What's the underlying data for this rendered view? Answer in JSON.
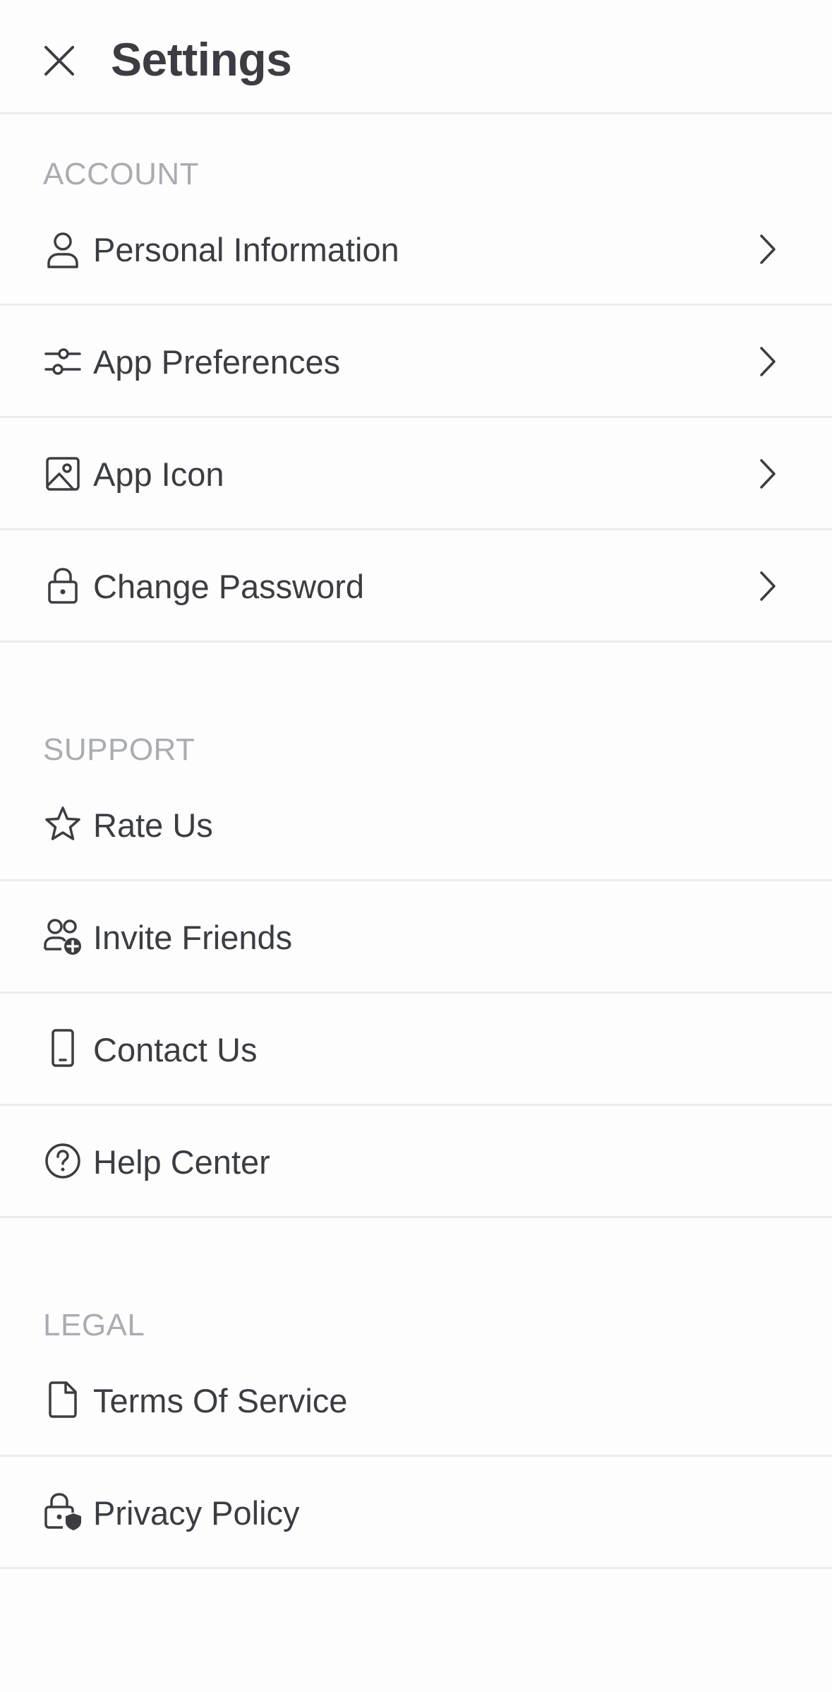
{
  "header": {
    "title": "Settings"
  },
  "sections": [
    {
      "label": "ACCOUNT",
      "items": [
        {
          "label": "Personal Information",
          "icon": "person-icon",
          "chevron": true
        },
        {
          "label": "App Preferences",
          "icon": "sliders-icon",
          "chevron": true
        },
        {
          "label": "App Icon",
          "icon": "image-icon",
          "chevron": true
        },
        {
          "label": "Change Password",
          "icon": "lock-icon",
          "chevron": true
        }
      ]
    },
    {
      "label": "SUPPORT",
      "items": [
        {
          "label": "Rate Us",
          "icon": "star-icon",
          "chevron": false
        },
        {
          "label": "Invite Friends",
          "icon": "add-users-icon",
          "chevron": false
        },
        {
          "label": "Contact Us",
          "icon": "phone-icon",
          "chevron": false
        },
        {
          "label": "Help Center",
          "icon": "help-circle-icon",
          "chevron": false
        }
      ]
    },
    {
      "label": "LEGAL",
      "items": [
        {
          "label": "Terms Of Service",
          "icon": "document-icon",
          "chevron": false
        },
        {
          "label": "Privacy Policy",
          "icon": "privacy-lock-icon",
          "chevron": false
        }
      ]
    }
  ],
  "colors": {
    "text": "#3a3d42",
    "section_label": "#a9acb2",
    "divider": "#ececec",
    "background": "#fdfdfd"
  }
}
